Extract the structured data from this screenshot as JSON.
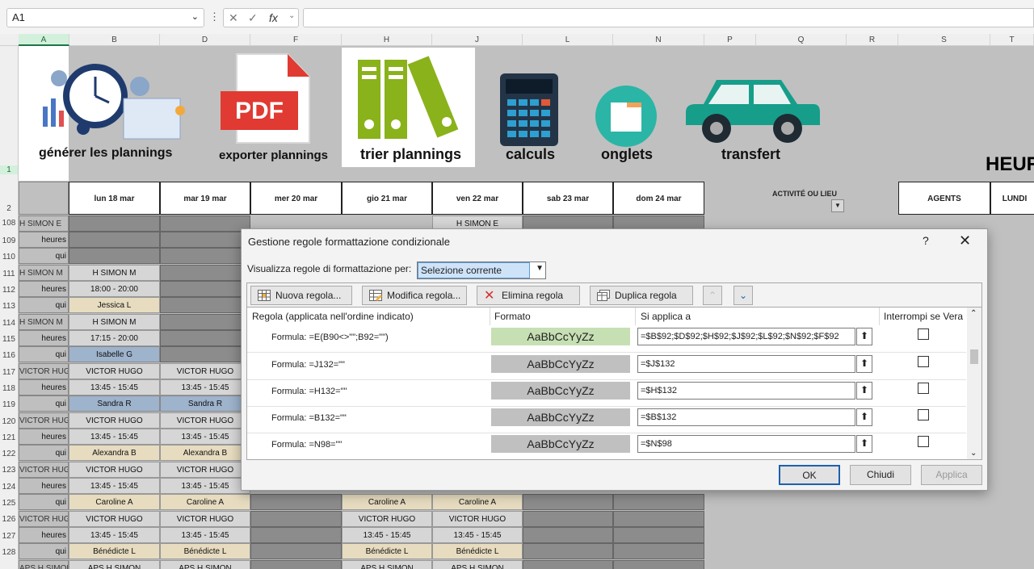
{
  "formula_bar": {
    "name_box": "A1",
    "fx": "fx",
    "content": ""
  },
  "columns": [
    "A",
    "B",
    "D",
    "F",
    "H",
    "J",
    "L",
    "N",
    "P",
    "Q",
    "R",
    "S",
    "T"
  ],
  "rows": [
    "1",
    "2",
    "108",
    "109",
    "110",
    "111",
    "112",
    "113",
    "114",
    "115",
    "116",
    "117",
    "118",
    "119",
    "120",
    "121",
    "122",
    "123",
    "124",
    "125",
    "126",
    "127",
    "128"
  ],
  "banner": {
    "b1": "générer les plannings",
    "b2": "exporter plannings",
    "b2_pdf": "PDF",
    "b3": "trier plannings",
    "b4": "calculs",
    "b5": "onglets",
    "b6": "transfert",
    "heur": "HEUR"
  },
  "days": [
    "lun 18 mar",
    "mar 19 mar",
    "mer 20 mar",
    "gio 21 mar",
    "ven 22 mar",
    "sab 23 mar",
    "dom 24 mar"
  ],
  "right_headers": {
    "activity": "ACTIVITÉ OU LIEU",
    "agents": "AGENTS",
    "lundi": "LUNDI"
  },
  "grid": {
    "r108": {
      "a": "H SIMON E",
      "j": "H SIMON E"
    },
    "r109": {
      "a": "heures"
    },
    "r110": {
      "a": "qui"
    },
    "r111": {
      "a": "H SIMON M",
      "b": "H SIMON M"
    },
    "r112": {
      "a": "heures",
      "b": "18:00 - 20:00"
    },
    "r113": {
      "a": "qui",
      "b": "Jessica L"
    },
    "r114": {
      "a": "H SIMON M",
      "b": "H SIMON M"
    },
    "r115": {
      "a": "heures",
      "b": "17:15 - 20:00"
    },
    "r116": {
      "a": "qui",
      "b": "Isabelle G"
    },
    "r117": {
      "a": "VICTOR HUG",
      "b": "VICTOR HUGO",
      "d": "VICTOR HUGO"
    },
    "r118": {
      "a": "heures",
      "b": "13:45 - 15:45",
      "d": "13:45 - 15:45"
    },
    "r119": {
      "a": "qui",
      "b": "Sandra R",
      "d": "Sandra R"
    },
    "r120": {
      "a": "VICTOR HUG",
      "b": "VICTOR HUGO",
      "d": "VICTOR HUGO"
    },
    "r121": {
      "a": "heures",
      "b": "13:45 - 15:45",
      "d": "13:45 - 15:45"
    },
    "r122": {
      "a": "qui",
      "b": "Alexandra B",
      "d": "Alexandra B"
    },
    "r123": {
      "a": "VICTOR HUG",
      "b": "VICTOR HUGO",
      "d": "VICTOR HUGO"
    },
    "r124": {
      "a": "heures",
      "b": "13:45 - 15:45",
      "d": "13:45 - 15:45"
    },
    "r125": {
      "a": "qui",
      "b": "Caroline A",
      "d": "Caroline A",
      "h": "Caroline A",
      "j": "Caroline A"
    },
    "r126": {
      "a": "VICTOR HUG",
      "b": "VICTOR HUGO",
      "d": "VICTOR HUGO",
      "h": "VICTOR HUGO",
      "j": "VICTOR HUGO"
    },
    "r127": {
      "a": "heures",
      "b": "13:45 - 15:45",
      "d": "13:45 - 15:45",
      "h": "13:45 - 15:45",
      "j": "13:45 - 15:45"
    },
    "r128": {
      "a": "qui",
      "b": "Bénédicte L",
      "d": "Bénédicte L",
      "h": "Bénédicte L",
      "j": "Bénédicte L"
    },
    "r129": {
      "a": "APS H SIMON",
      "b": "APS H SIMON",
      "d": "APS H SIMON",
      "h": "APS H SIMON",
      "j": "APS H SIMON"
    }
  },
  "dialog": {
    "title": "Gestione regole formattazione condizionale",
    "help": "?",
    "close": "✕",
    "show_label": "Visualizza regole di formattazione per:",
    "show_value": "Selezione corrente",
    "buttons": {
      "new": "Nuova regola...",
      "edit": "Modifica regola...",
      "delete": "Elimina regola",
      "duplicate": "Duplica regola"
    },
    "headers": {
      "rule": "Regola (applicata nell'ordine indicato)",
      "format": "Formato",
      "applies": "Si applica a",
      "stop": "Interrompi se Vera"
    },
    "rules": [
      {
        "formula": "Formula: =E(B90<>\"\";B92=\"\")",
        "sample": "AaBbCcYyZz",
        "color": "#c6e0b4",
        "applies": "=$B$92;$D$92;$H$92;$J$92;$L$92;$N$92;$F$92"
      },
      {
        "formula": "Formula: =J132=\"\"",
        "sample": "AaBbCcYyZz",
        "color": "#c0c0c0",
        "applies": "=$J$132"
      },
      {
        "formula": "Formula: =H132=\"\"",
        "sample": "AaBbCcYyZz",
        "color": "#c0c0c0",
        "applies": "=$H$132"
      },
      {
        "formula": "Formula: =B132=\"\"",
        "sample": "AaBbCcYyZz",
        "color": "#c0c0c0",
        "applies": "=$B$132"
      },
      {
        "formula": "Formula: =N98=\"\"",
        "sample": "AaBbCcYyZz",
        "color": "#c0c0c0",
        "applies": "=$N$98"
      }
    ],
    "ok": "OK",
    "cancel": "Chiudi",
    "apply": "Applica"
  }
}
